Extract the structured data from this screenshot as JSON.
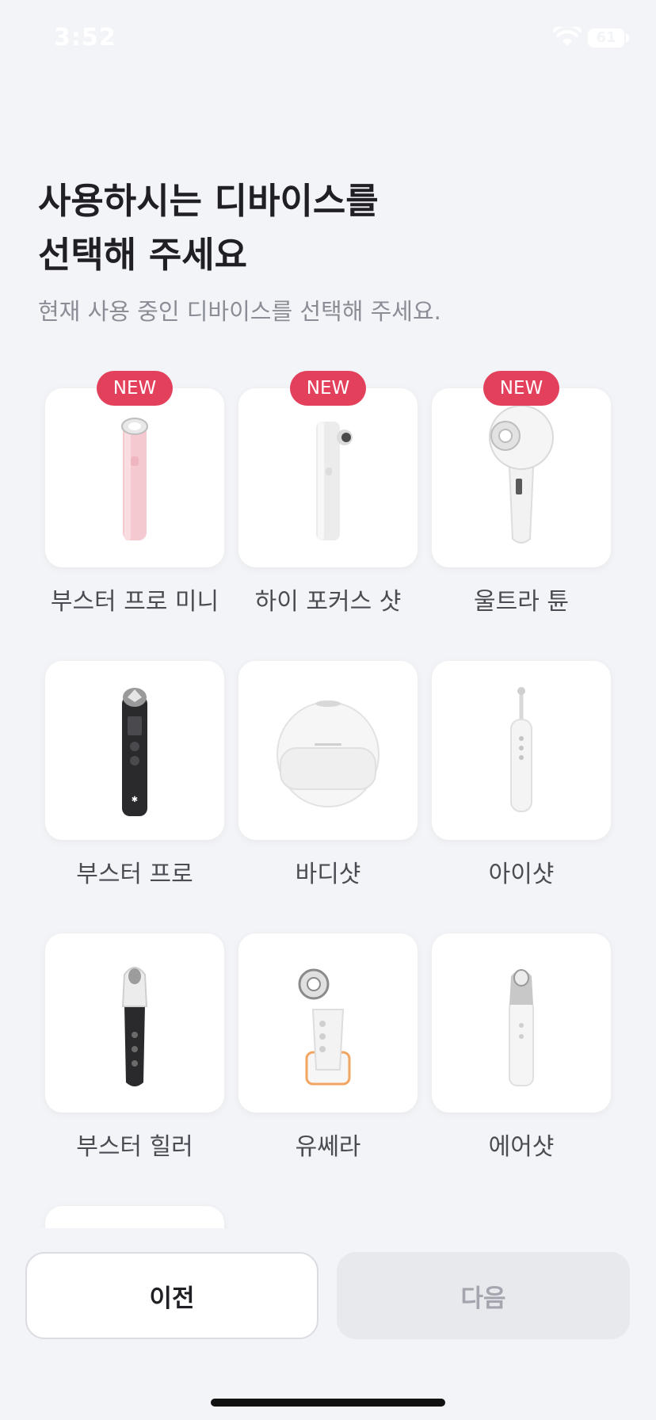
{
  "status_bar": {
    "time": "3:52",
    "battery": "61"
  },
  "header": {
    "title_line1": "사용하시는 디바이스를",
    "title_line2": "선택해 주세요",
    "subtitle": "현재 사용 중인 디바이스를 선택해 주세요."
  },
  "devices": [
    {
      "name": "부스터 프로 미니",
      "badge": "NEW"
    },
    {
      "name": "하이 포커스 샷",
      "badge": "NEW"
    },
    {
      "name": "울트라 튠",
      "badge": "NEW"
    },
    {
      "name": "부스터 프로"
    },
    {
      "name": "바디샷"
    },
    {
      "name": "아이샷"
    },
    {
      "name": "부스터 힐러"
    },
    {
      "name": "유쎄라"
    },
    {
      "name": "에어샷"
    }
  ],
  "footer": {
    "prev_label": "이전",
    "next_label": "다음"
  },
  "colors": {
    "accent": "#e3405c",
    "background": "#f3f4f7",
    "card": "#ffffff"
  }
}
